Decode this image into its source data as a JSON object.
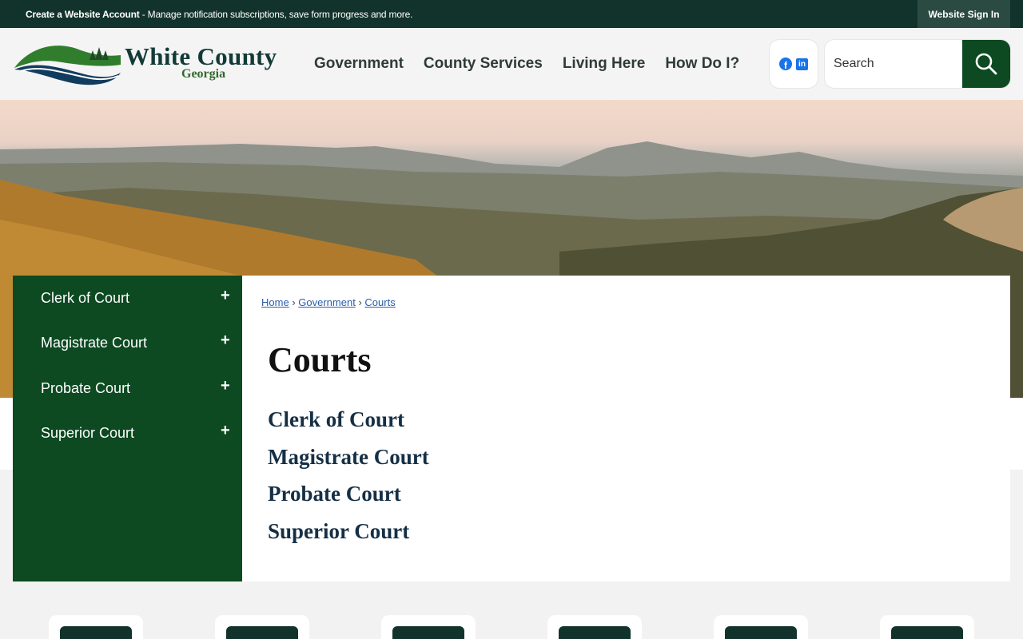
{
  "topbar": {
    "account_bold": "Create a Website Account",
    "account_rest": " - Manage notification subscriptions, save form progress and more.",
    "signin": "Website Sign In"
  },
  "header": {
    "logo_title": "White County",
    "logo_sub": "Georgia",
    "nav": [
      "Government",
      "County Services",
      "Living Here",
      "How Do I?"
    ],
    "search_placeholder": "Search"
  },
  "sidebar": {
    "items": [
      {
        "label": "Clerk of Court",
        "toggle": "+"
      },
      {
        "label": "Magistrate Court",
        "toggle": "+"
      },
      {
        "label": "Probate Court",
        "toggle": "+"
      },
      {
        "label": "Superior Court",
        "toggle": "+"
      }
    ]
  },
  "breadcrumb": {
    "home": "Home",
    "sep": "›",
    "government": "Government",
    "courts": "Courts"
  },
  "page": {
    "title": "Courts",
    "links": [
      "Clerk of Court",
      "Magistrate Court",
      "Probate Court",
      "Superior Court"
    ]
  },
  "colors": {
    "topbar": "#12332b",
    "accent_green": "#0d4a22",
    "link_navy": "#152f45"
  }
}
